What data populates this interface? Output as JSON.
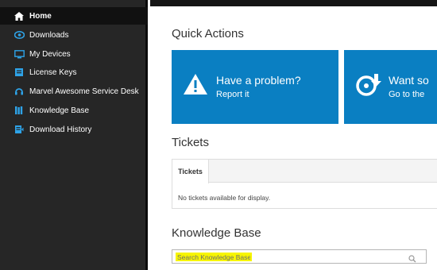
{
  "sidebar": {
    "items": [
      {
        "label": "Home",
        "icon": "home-icon"
      },
      {
        "label": "Downloads",
        "icon": "cloud-icon"
      },
      {
        "label": "My Devices",
        "icon": "monitor-icon"
      },
      {
        "label": "License Keys",
        "icon": "key-icon"
      },
      {
        "label": "Marvel Awesome Service Desk",
        "icon": "headset-icon"
      },
      {
        "label": "Knowledge Base",
        "icon": "books-icon"
      },
      {
        "label": "Download History",
        "icon": "history-icon"
      }
    ]
  },
  "quick_actions": {
    "title": "Quick Actions",
    "cards": [
      {
        "title": "Have a problem?",
        "subtitle": "Report it",
        "icon": "warning-icon"
      },
      {
        "title": "Want so",
        "subtitle": "Go to the",
        "icon": "download-disc-icon"
      }
    ]
  },
  "tickets": {
    "title": "Tickets",
    "tab_label": "Tickets",
    "empty_message": "No tickets available for display."
  },
  "knowledge_base": {
    "title": "Knowledge Base",
    "search_placeholder": "Search Knowledge Base"
  },
  "colors": {
    "sidebar_bg": "#262626",
    "sidebar_active": "#111111",
    "accent_blue": "#0a7fc2",
    "highlight": "#f7f500",
    "icon_blue": "#2ea3e8"
  }
}
